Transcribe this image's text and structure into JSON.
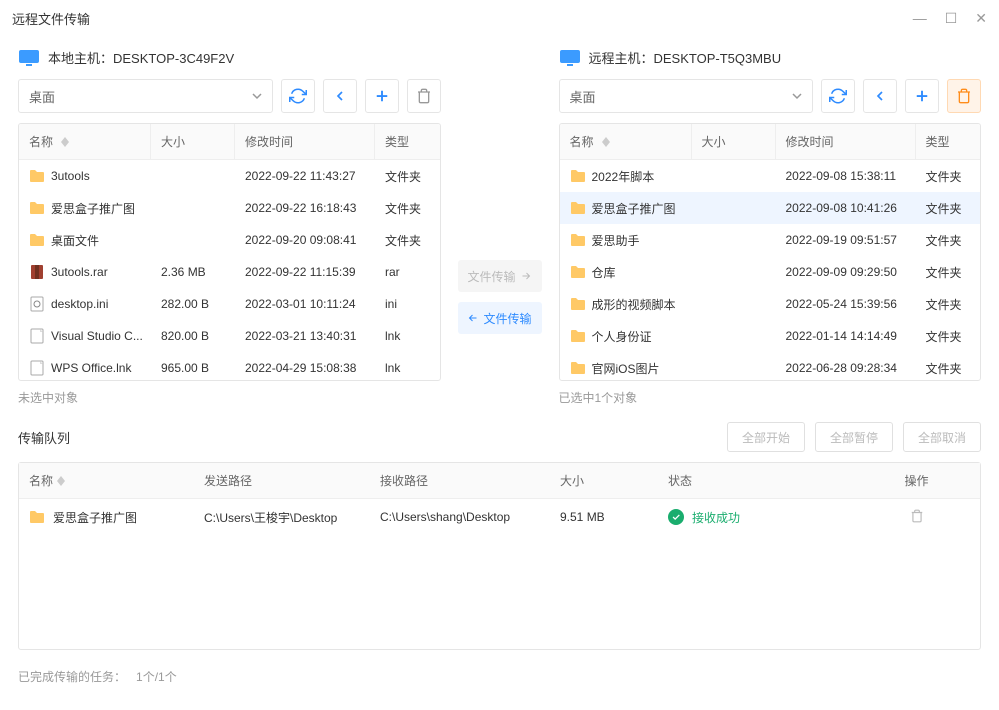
{
  "window": {
    "title": "远程文件传输"
  },
  "local": {
    "label": "本地主机：DESKTOP-3C49F2V",
    "location": "桌面",
    "columns": {
      "name": "名称",
      "size": "大小",
      "date": "修改时间",
      "type": "类型"
    },
    "files": [
      {
        "name": "3utools",
        "size": "",
        "date": "2022-09-22 11:43:27",
        "type": "文件夹",
        "icon": "folder"
      },
      {
        "name": "爱思盒子推广图",
        "size": "",
        "date": "2022-09-22 16:18:43",
        "type": "文件夹",
        "icon": "folder"
      },
      {
        "name": "桌面文件",
        "size": "",
        "date": "2022-09-20 09:08:41",
        "type": "文件夹",
        "icon": "folder"
      },
      {
        "name": "3utools.rar",
        "size": "2.36 MB",
        "date": "2022-09-22 11:15:39",
        "type": "rar",
        "icon": "rar"
      },
      {
        "name": "desktop.ini",
        "size": "282.00 B",
        "date": "2022-03-01 10:11:24",
        "type": "ini",
        "icon": "ini"
      },
      {
        "name": "Visual Studio C...",
        "size": "820.00 B",
        "date": "2022-03-21 13:40:31",
        "type": "lnk",
        "icon": "lnk"
      },
      {
        "name": "WPS Office.lnk",
        "size": "965.00 B",
        "date": "2022-04-29 15:08:38",
        "type": "lnk",
        "icon": "lnk"
      }
    ],
    "status": "未选中对象"
  },
  "remote": {
    "label": "远程主机：DESKTOP-T5Q3MBU",
    "location": "桌面",
    "columns": {
      "name": "名称",
      "size": "大小",
      "date": "修改时间",
      "type": "类型"
    },
    "files": [
      {
        "name": "2022年脚本",
        "size": "",
        "date": "2022-09-08 15:38:11",
        "type": "文件夹",
        "icon": "folder"
      },
      {
        "name": "爱思盒子推广图",
        "size": "",
        "date": "2022-09-08 10:41:26",
        "type": "文件夹",
        "icon": "folder",
        "selected": true
      },
      {
        "name": "爱思助手",
        "size": "",
        "date": "2022-09-19 09:51:57",
        "type": "文件夹",
        "icon": "folder"
      },
      {
        "name": "仓库",
        "size": "",
        "date": "2022-09-09 09:29:50",
        "type": "文件夹",
        "icon": "folder"
      },
      {
        "name": "成形的视频脚本",
        "size": "",
        "date": "2022-05-24 15:39:56",
        "type": "文件夹",
        "icon": "folder"
      },
      {
        "name": "个人身份证",
        "size": "",
        "date": "2022-01-14 14:14:49",
        "type": "文件夹",
        "icon": "folder"
      },
      {
        "name": "官网iOS图片",
        "size": "",
        "date": "2022-06-28 09:28:34",
        "type": "文件夹",
        "icon": "folder"
      }
    ],
    "status": "已选中1个对象"
  },
  "transfer": {
    "to_remote": "文件传输",
    "to_local": "文件传输"
  },
  "queue": {
    "title": "传输队列",
    "actions": {
      "start": "全部开始",
      "pause": "全部暂停",
      "cancel": "全部取消"
    },
    "columns": {
      "name": "名称",
      "send": "发送路径",
      "recv": "接收路径",
      "size": "大小",
      "status": "状态",
      "action": "操作"
    },
    "rows": [
      {
        "name": "爱思盒子推广图",
        "send": "C:\\Users\\王梭宇\\Desktop",
        "recv": "C:\\Users\\shang\\Desktop",
        "size": "9.51 MB",
        "status": "接收成功"
      }
    ]
  },
  "footer": {
    "text": "已完成传输的任务：",
    "count": "1个/1个"
  }
}
